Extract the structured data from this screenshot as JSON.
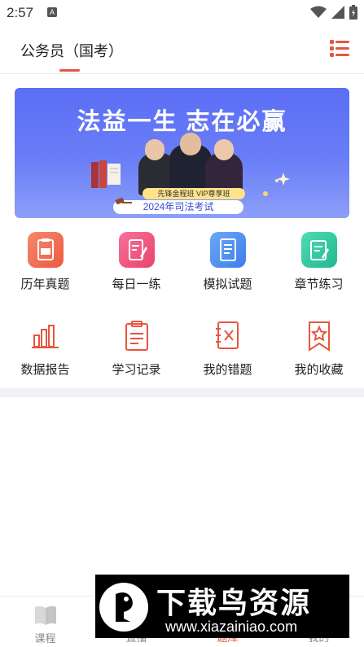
{
  "status_bar": {
    "time": "2:57",
    "notif_glyph": "A"
  },
  "header": {
    "title": "公务员（国考）",
    "menu_icon": "list-menu-icon",
    "accent": "#e8553e"
  },
  "banner": {
    "headline": "法益一生  志在必赢",
    "badge_top": "先锋金程班  VIP尊享班",
    "badge_bottom": "2024年司法考试"
  },
  "grid": {
    "row1": [
      {
        "label": "历年真题",
        "icon": "past-papers-icon",
        "color": "#f26b4f"
      },
      {
        "label": "每日一练",
        "icon": "daily-practice-icon",
        "color": "#f0527a"
      },
      {
        "label": "模拟试题",
        "icon": "mock-test-icon",
        "color": "#4f8fef"
      },
      {
        "label": "章节练习",
        "icon": "chapter-practice-icon",
        "color": "#2ec7a3"
      }
    ],
    "row2": [
      {
        "label": "数据报告",
        "icon": "data-report-icon"
      },
      {
        "label": "学习记录",
        "icon": "study-record-icon"
      },
      {
        "label": "我的错题",
        "icon": "wrong-questions-icon"
      },
      {
        "label": "我的收藏",
        "icon": "favorites-icon"
      }
    ]
  },
  "bottom_nav": [
    {
      "label": "课程",
      "icon": "course-book-icon"
    },
    {
      "label": "直播",
      "icon": "live-icon"
    },
    {
      "label": "题库",
      "icon": "question-bank-icon"
    },
    {
      "label": "我的",
      "icon": "profile-icon"
    }
  ],
  "watermark": {
    "title": "下载鸟资源",
    "url": "www.xiazainiao.com"
  }
}
